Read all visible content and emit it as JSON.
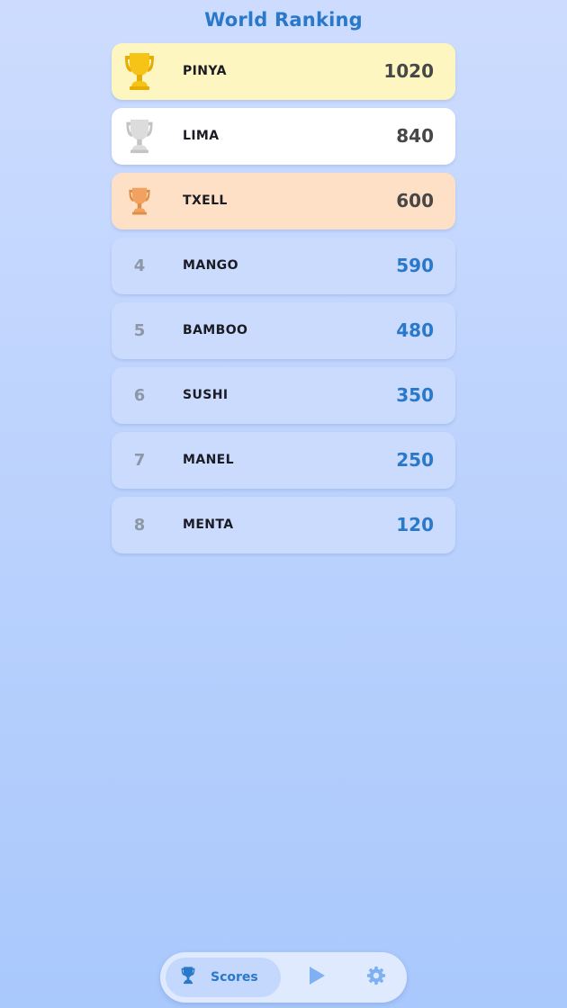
{
  "header": {
    "title": "World Ranking"
  },
  "ranking": [
    {
      "rank": "1",
      "name": "PINYA",
      "score": "1020",
      "trophy": "gold-trophy-icon"
    },
    {
      "rank": "2",
      "name": "LIMA",
      "score": "840",
      "trophy": "silver-trophy-icon"
    },
    {
      "rank": "3",
      "name": "TXELL",
      "score": "600",
      "trophy": "bronze-trophy-icon"
    },
    {
      "rank": "4",
      "name": "MANGO",
      "score": "590"
    },
    {
      "rank": "5",
      "name": "BAMBOO",
      "score": "480"
    },
    {
      "rank": "6",
      "name": "SUSHI",
      "score": "350"
    },
    {
      "rank": "7",
      "name": "MANEL",
      "score": "250"
    },
    {
      "rank": "8",
      "name": "MENTA",
      "score": "120"
    }
  ],
  "nav": {
    "scores_label": "Scores",
    "scores_icon": "trophy-icon",
    "play_icon": "play-icon",
    "settings_icon": "gear-icon",
    "active": "Scores"
  },
  "colors": {
    "accent": "#2a78c9",
    "gold_row": "#fef6c0",
    "silver_row": "#ffffff",
    "bronze_row": "#fde0c6",
    "default_row": "#cadbfd",
    "gold_trophy": "#f6c417",
    "silver_trophy": "#d9d9d9",
    "bronze_trophy": "#f2a260"
  }
}
